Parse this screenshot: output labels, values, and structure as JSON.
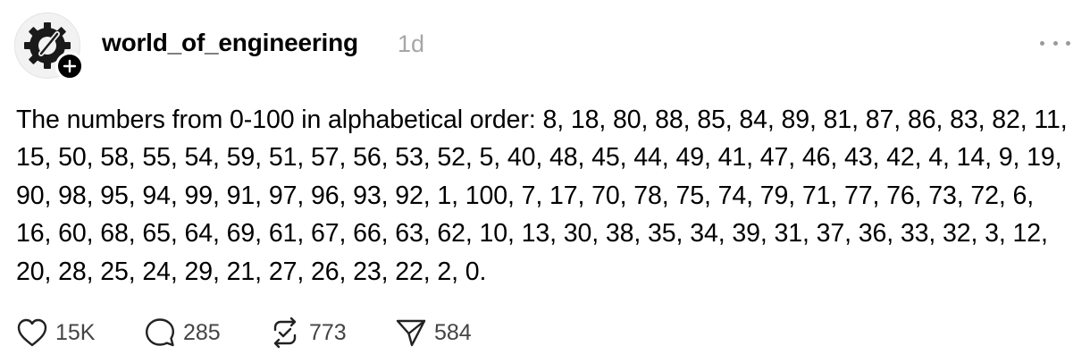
{
  "post": {
    "username": "world_of_engineering",
    "timestamp": "1d",
    "text": "The numbers from 0-100 in alphabetical order: 8, 18, 80, 88, 85, 84, 89, 81, 87, 86, 83, 82, 11, 15, 50, 58, 55, 54, 59, 51, 57, 56, 53, 52, 5, 40, 48, 45, 44, 49, 41, 47, 46, 43, 42, 4, 14, 9, 19, 90, 98, 95, 94, 99, 91, 97, 96, 93, 92, 1, 100, 7, 17, 70, 78, 75, 74, 79, 71, 77, 76, 73, 72, 6, 16, 60, 68, 65, 64, 69, 61, 67, 66, 63, 62, 10, 13, 30, 38, 35, 34, 39, 31, 37, 36, 33, 32, 3, 12, 20, 28, 25, 24, 29, 21, 27, 26, 23, 22, 2, 0."
  },
  "actions": {
    "likes": "15K",
    "comments": "285",
    "reposts": "773",
    "shares": "584"
  },
  "icons": {
    "avatar": "gear-logo-icon",
    "follow": "plus-icon",
    "more": "more-icon",
    "like": "heart-icon",
    "comment": "comment-icon",
    "repost": "repost-icon",
    "share": "send-icon"
  }
}
